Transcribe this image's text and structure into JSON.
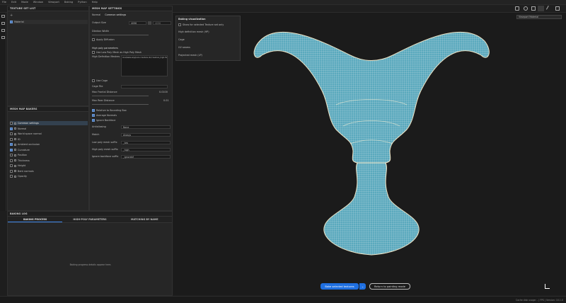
{
  "menu": [
    "File",
    "Edit",
    "Mode",
    "Window",
    "Viewport",
    "Baking",
    "Python",
    "Help"
  ],
  "texture_set": {
    "title": "TEXTURE SET LIST",
    "item": "Material"
  },
  "bake_settings": {
    "title": "MESH MAP SETTINGS",
    "tabs": [
      "Normal",
      "Common settings"
    ],
    "output_size_label": "Output Size",
    "output_size_value": "4096",
    "output_size_value2": "4096",
    "dilation_label": "Dilation Width",
    "apply_diffusion_label": "Apply Diffusion",
    "high_poly_section": "High poly parameters",
    "use_low_poly_label": "Use Low Poly Mesh as High Poly Mesh",
    "high_def_meshes_label": "High Definition Meshes",
    "high_def_meshes_value": "lora/bake-wip/pure-creature-dir/creature_high-fixe",
    "use_cage_label": "Use Cage",
    "cage_file_label": "Cage File",
    "max_frontal_label": "Max Frontal Distance",
    "max_frontal_value": "0.0100",
    "max_rear_label": "Max Rear Distance",
    "max_rear_value": "0.01",
    "relative_label": "Relative to Bounding Box",
    "average_normals_label": "Average Normals",
    "ignore_backface_label": "Ignore Backface",
    "antialiasing_label": "Antialiasing",
    "antialiasing_value": "None",
    "match_label": "Match",
    "match_value": "Always",
    "low_poly_suffix_label": "Low poly mesh suffix",
    "low_poly_suffix_value": "_low",
    "high_poly_suffix_label": "High poly mesh suffix",
    "high_poly_suffix_value": "_high",
    "ignore_backface_suffix_label": "Ignore backface suffix",
    "ignore_backface_suffix_value": "_ignorebf"
  },
  "mesh_maps": {
    "title": "MESH MAP BAKERS",
    "items": [
      {
        "label": "Common settings",
        "checked": false,
        "selected": true
      },
      {
        "label": "Normal",
        "checked": true,
        "selected": false
      },
      {
        "label": "World space normal",
        "checked": false,
        "selected": false
      },
      {
        "label": "ID",
        "checked": false,
        "selected": false
      },
      {
        "label": "Ambient occlusion",
        "checked": true,
        "selected": false
      },
      {
        "label": "Curvature",
        "checked": true,
        "selected": false
      },
      {
        "label": "Position",
        "checked": false,
        "selected": false
      },
      {
        "label": "Thickness",
        "checked": false,
        "selected": false
      },
      {
        "label": "Height",
        "checked": false,
        "selected": false
      },
      {
        "label": "Bent normals",
        "checked": false,
        "selected": false
      },
      {
        "label": "Opacity",
        "checked": false,
        "selected": false
      }
    ]
  },
  "baking_log": {
    "title": "BAKING LOG",
    "tabs": [
      "BAKING PROCESS",
      "HIGH-POLY PARAMETERS",
      "MATCHING BY NAME"
    ],
    "empty_text": "Baking progress details appear here."
  },
  "viz_panel": {
    "title": "Baking visualization",
    "show_selected_label": "Show for selected Texture set only",
    "sections": [
      "High definition mesh (HP)",
      "Cage",
      "UV seams",
      "Projected mesh (LP)"
    ]
  },
  "viewport": {
    "view_mode": "Viewport Material",
    "bake_button": "Bake selected textures",
    "return_button": "Return to painting mode"
  },
  "status": "Cache disk usage: - | FPS | Version: 10.1.0"
}
